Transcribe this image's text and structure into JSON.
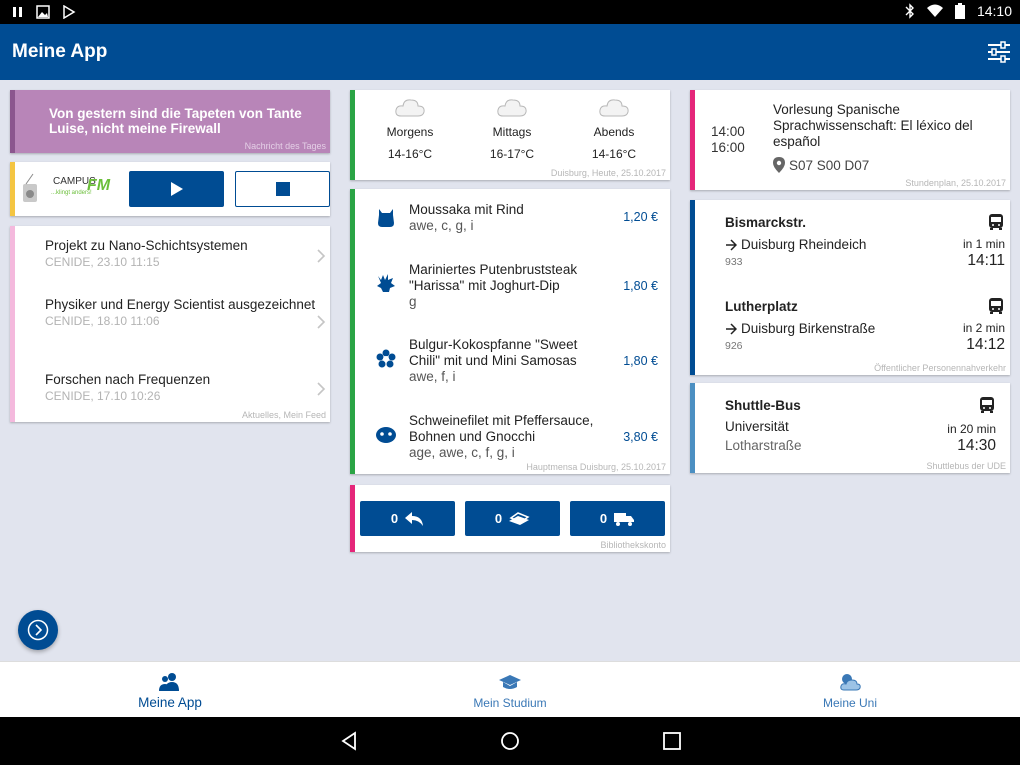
{
  "status": {
    "time": "14:10"
  },
  "app": {
    "title": "Meine App"
  },
  "quote": {
    "text": "Von gestern sind die Tapeten von Tante Luise, nicht meine Firewall",
    "footer": "Nachricht des Tages"
  },
  "radio": {
    "logo_main": "CAMPUS",
    "logo_fm": "FM",
    "logo_tag": "...klingt anders!"
  },
  "news": {
    "items": [
      {
        "title": "Projekt zu Nano-Schichtsystemen",
        "meta": "CENIDE, 23.10 11:15"
      },
      {
        "title": "Physiker und Energy Scientist ausgezeichnet",
        "meta": "CENIDE, 18.10 11:06"
      },
      {
        "title": "Forschen nach Frequenzen",
        "meta": "CENIDE, 17.10 10:26"
      }
    ],
    "footer": "Aktuelles, Mein Feed"
  },
  "weather": {
    "slots": [
      {
        "label": "Morgens",
        "temp": "14-16°C"
      },
      {
        "label": "Mittags",
        "temp": "16-17°C"
      },
      {
        "label": "Abends",
        "temp": "14-16°C"
      }
    ],
    "footer": "Duisburg, Heute, 25.10.2017"
  },
  "mensa": {
    "meals": [
      {
        "name": "Moussaka mit Rind",
        "tags": "awe, c, g, i",
        "price": "1,20 €",
        "icon": "cow-icon"
      },
      {
        "name": "Mariniertes Putenbruststeak \"Harissa\" mit Joghurt-Dip",
        "tags": "g",
        "price": "1,80 €",
        "icon": "turkey-icon"
      },
      {
        "name": "Bulgur-Kokospfanne \"Sweet Chili\" mit und Mini Samosas",
        "tags": "awe, f, i",
        "price": "1,80 €",
        "icon": "flower-icon"
      },
      {
        "name": "Schweinefilet mit Pfeffersauce, Bohnen und Gnocchi",
        "tags": "age, awe, c, f, g, i",
        "price": "3,80 €",
        "icon": "pig-icon"
      }
    ],
    "footer": "Hauptmensa Duisburg, 25.10.2017"
  },
  "library": {
    "buttons": [
      {
        "count": "0",
        "icon": "return-icon"
      },
      {
        "count": "0",
        "icon": "books-icon"
      },
      {
        "count": "0",
        "icon": "truck-icon"
      }
    ],
    "footer": "Bibliothekskonto"
  },
  "lecture": {
    "start": "14:00",
    "end": "16:00",
    "title": "Vorlesung Spanische Sprachwissenschaft: El léxico del español",
    "room": "S07 S00 D07",
    "footer": "Stundenplan, 25.10.2017"
  },
  "transit": {
    "stops": [
      {
        "name": "Bismarckstr.",
        "direction": "Duisburg Rheindeich",
        "line": "933",
        "in": "in 1 min",
        "time": "14:11"
      },
      {
        "name": "Lutherplatz",
        "direction": "Duisburg Birkenstraße",
        "line": "926",
        "in": "in 2 min",
        "time": "14:12"
      }
    ],
    "footer": "Öffentlicher Personennahverkehr"
  },
  "shuttle": {
    "name": "Shuttle-Bus",
    "from": "Universität",
    "to": "Lotharstraße",
    "in": "in 20 min",
    "time": "14:30",
    "footer": "Shuttlebus der UDE"
  },
  "nav": {
    "tabs": [
      {
        "label": "Meine App",
        "icon": "people-icon"
      },
      {
        "label": "Mein Studium",
        "icon": "graduation-cap-icon"
      },
      {
        "label": "Meine Uni",
        "icon": "weather-cloud-icon"
      }
    ]
  },
  "colors": {
    "primary": "#004c93",
    "quote": "#b885b8",
    "mensa": "#2aa445",
    "pink": "#e5267a"
  }
}
